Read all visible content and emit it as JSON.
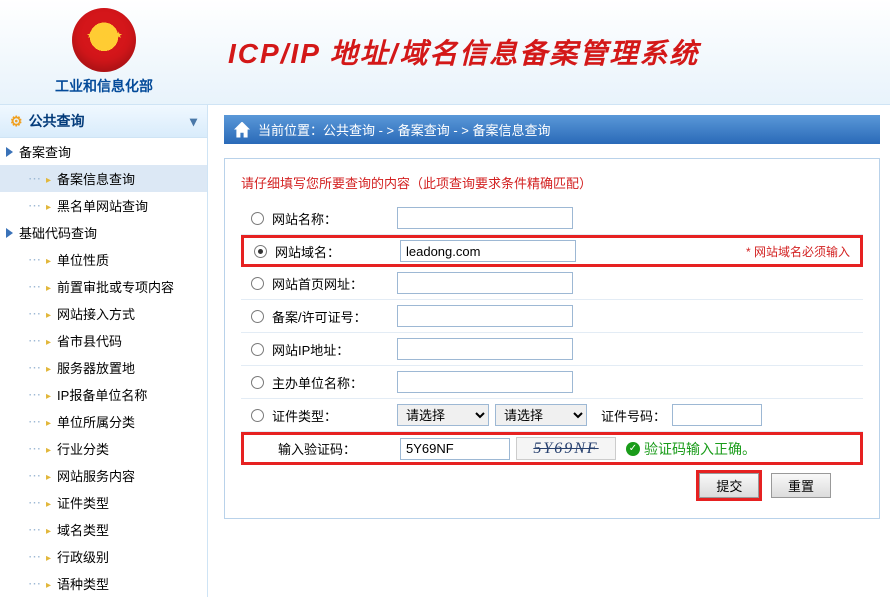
{
  "header": {
    "org": "工业和信息化部",
    "app_title": "ICP/IP 地址/域名信息备案管理系统"
  },
  "sidebar": {
    "category_label": "公共查询",
    "groups": [
      {
        "label": "备案查询",
        "items": [
          {
            "label": "备案信息查询",
            "selected": true
          },
          {
            "label": "黑名单网站查询",
            "selected": false
          }
        ]
      },
      {
        "label": "基础代码查询",
        "items": [
          {
            "label": "单位性质"
          },
          {
            "label": "前置审批或专项内容"
          },
          {
            "label": "网站接入方式"
          },
          {
            "label": "省市县代码"
          },
          {
            "label": "服务器放置地"
          },
          {
            "label": "IP报备单位名称"
          },
          {
            "label": "单位所属分类"
          },
          {
            "label": "行业分类"
          },
          {
            "label": "网站服务内容"
          },
          {
            "label": "证件类型"
          },
          {
            "label": "域名类型"
          },
          {
            "label": "行政级别"
          },
          {
            "label": "语种类型"
          }
        ]
      }
    ]
  },
  "breadcrumb": {
    "prefix": "当前位置：",
    "items": [
      "公共查询",
      "备案查询",
      "备案信息查询"
    ],
    "sep": " - > "
  },
  "form": {
    "hint": "请仔细填写您所要查询的内容（此项查询要求条件精确匹配）",
    "fields": {
      "site_name": {
        "label": "网站名称：",
        "value": "",
        "checked": false
      },
      "site_domain": {
        "label": "网站域名：",
        "value": "leadong.com",
        "checked": true,
        "required_text": "* 网站域名必须输入"
      },
      "site_home": {
        "label": "网站首页网址：",
        "value": "",
        "checked": false
      },
      "license_no": {
        "label": "备案/许可证号：",
        "value": "",
        "checked": false
      },
      "site_ip": {
        "label": "网站IP地址：",
        "value": "",
        "checked": false
      },
      "sponsor": {
        "label": "主办单位名称：",
        "value": "",
        "checked": false
      }
    },
    "cert": {
      "label": "证件类型：",
      "select1": "请选择",
      "select2": "请选择",
      "cert_no_label": "证件号码："
    },
    "captcha": {
      "label": "输入验证码：",
      "value": "5Y69NF",
      "image_text": "5Y69NF",
      "ok_text": "验证码输入正确。"
    },
    "actions": {
      "submit": "提交",
      "reset": "重置"
    }
  }
}
